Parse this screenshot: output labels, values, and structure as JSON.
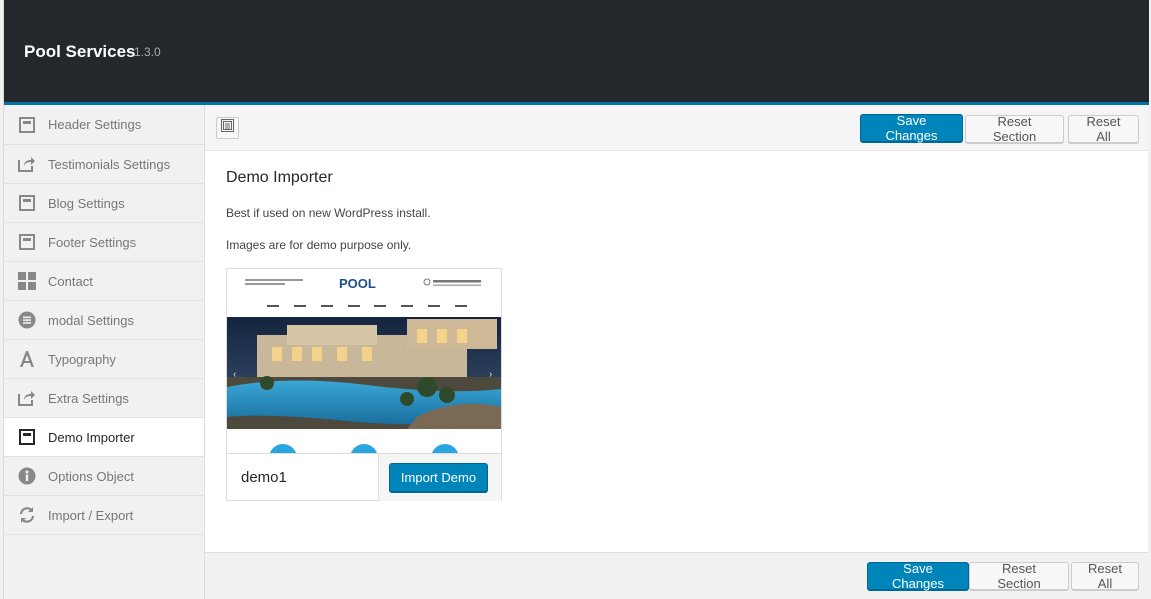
{
  "header": {
    "title": "Pool Services",
    "version": "1.3.0"
  },
  "sidebar": {
    "items": [
      {
        "label": "Header Settings",
        "icon": "layout-icon"
      },
      {
        "label": "Testimonials Settings",
        "icon": "share-icon"
      },
      {
        "label": "Blog Settings",
        "icon": "layout-icon"
      },
      {
        "label": "Footer Settings",
        "icon": "layout-icon"
      },
      {
        "label": "Contact",
        "icon": "grid-icon"
      },
      {
        "label": "modal Settings",
        "icon": "list-circle-icon"
      },
      {
        "label": "Typography",
        "icon": "typography-icon"
      },
      {
        "label": "Extra Settings",
        "icon": "share-icon"
      },
      {
        "label": "Demo Importer",
        "icon": "layout-icon",
        "active": true
      },
      {
        "label": "Options Object",
        "icon": "info-icon"
      },
      {
        "label": "Import / Export",
        "icon": "refresh-icon"
      }
    ]
  },
  "toolbar": {
    "save_label": "Save Changes",
    "reset_section_label": "Reset Section",
    "reset_all_label": "Reset All"
  },
  "content": {
    "title": "Demo Importer",
    "line1": "Best if used on new WordPress install.",
    "line2": "Images are for demo purpose only.",
    "demo": {
      "name": "demo1",
      "import_label": "Import Demo",
      "preview_logo": "POOL"
    }
  },
  "colors": {
    "primary": "#0085ba",
    "header_bg": "#23282d",
    "accent_bar": "#0073aa"
  }
}
